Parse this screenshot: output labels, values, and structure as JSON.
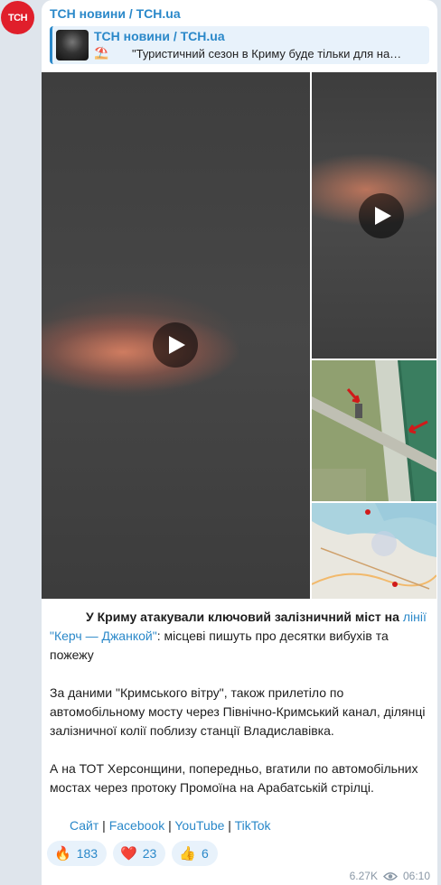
{
  "channel": {
    "avatar_text": "TCH",
    "name": "ТСН новини / TCH.ua",
    "accent_color": "#2a88c9",
    "avatar_color": "#e01f2b"
  },
  "reply": {
    "title": "ТСН новини / TCH.ua",
    "emoji": "⛱️",
    "text": "\"Туристичний сезон в Криму буде тільки для на…"
  },
  "media": {
    "video_icon": "play-icon"
  },
  "post": {
    "p1_bold": "У Криму атакували ключовий залізничний міст на",
    "p1_link": "лінії \"Керч — Джанкой\"",
    "p1_rest": ": місцеві пишуть про десятки вибухів та пожежу",
    "p2": "За даними \"Кримського вітру\", також прилетіло по автомобільному мосту через Північно-Кримський канал, ділянці залізничної колії поблизу станції Владиславівка.",
    "p3": "А на ТОТ Херсонщини, попередньо, вгатили по автомобільних мостах через протоку Промоїна на Арабатській стрілці."
  },
  "links": {
    "site": "Сайт",
    "sep": " | ",
    "facebook": "Facebook",
    "youtube": "YouTube",
    "tiktok": "TikTok"
  },
  "reactions": [
    {
      "emoji": "🔥",
      "count": "183"
    },
    {
      "emoji": "❤️",
      "count": "23"
    },
    {
      "emoji": "👍",
      "count": "6"
    }
  ],
  "meta": {
    "views": "6.27K",
    "views_icon": "eye-icon",
    "time": "06:10"
  }
}
